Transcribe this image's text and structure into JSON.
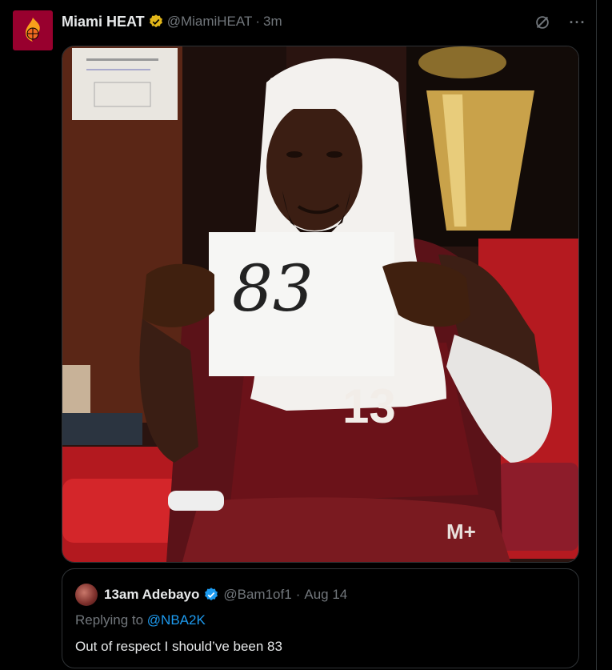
{
  "tweet": {
    "author_name": "Miami HEAT",
    "author_handle": "@MiamiHEAT",
    "separator": "·",
    "time": "3m",
    "verified_badge": "gold-verified-badge",
    "avatar_icon": "heat-logo-icon",
    "actions": [
      {
        "icon": "grok-icon"
      },
      {
        "icon": "more-icon",
        "label": "···"
      }
    ]
  },
  "photo": {
    "sign_text": "83",
    "jersey_number": "13"
  },
  "quoted_tweet": {
    "author_name": "13am Adebayo",
    "author_handle": "@Bam1of1",
    "separator": "·",
    "time": "Aug 14",
    "verified_badge": "blue-verified-badge",
    "replying_prefix": "Replying to ",
    "replying_handle": "@NBA2K",
    "text": "Out of respect I should’ve been 83"
  },
  "colors": {
    "background": "#000000",
    "heat_red": "#98002e",
    "link_blue": "#1d9bf0",
    "muted": "#71767b",
    "gold_badge": "#e2b719"
  }
}
